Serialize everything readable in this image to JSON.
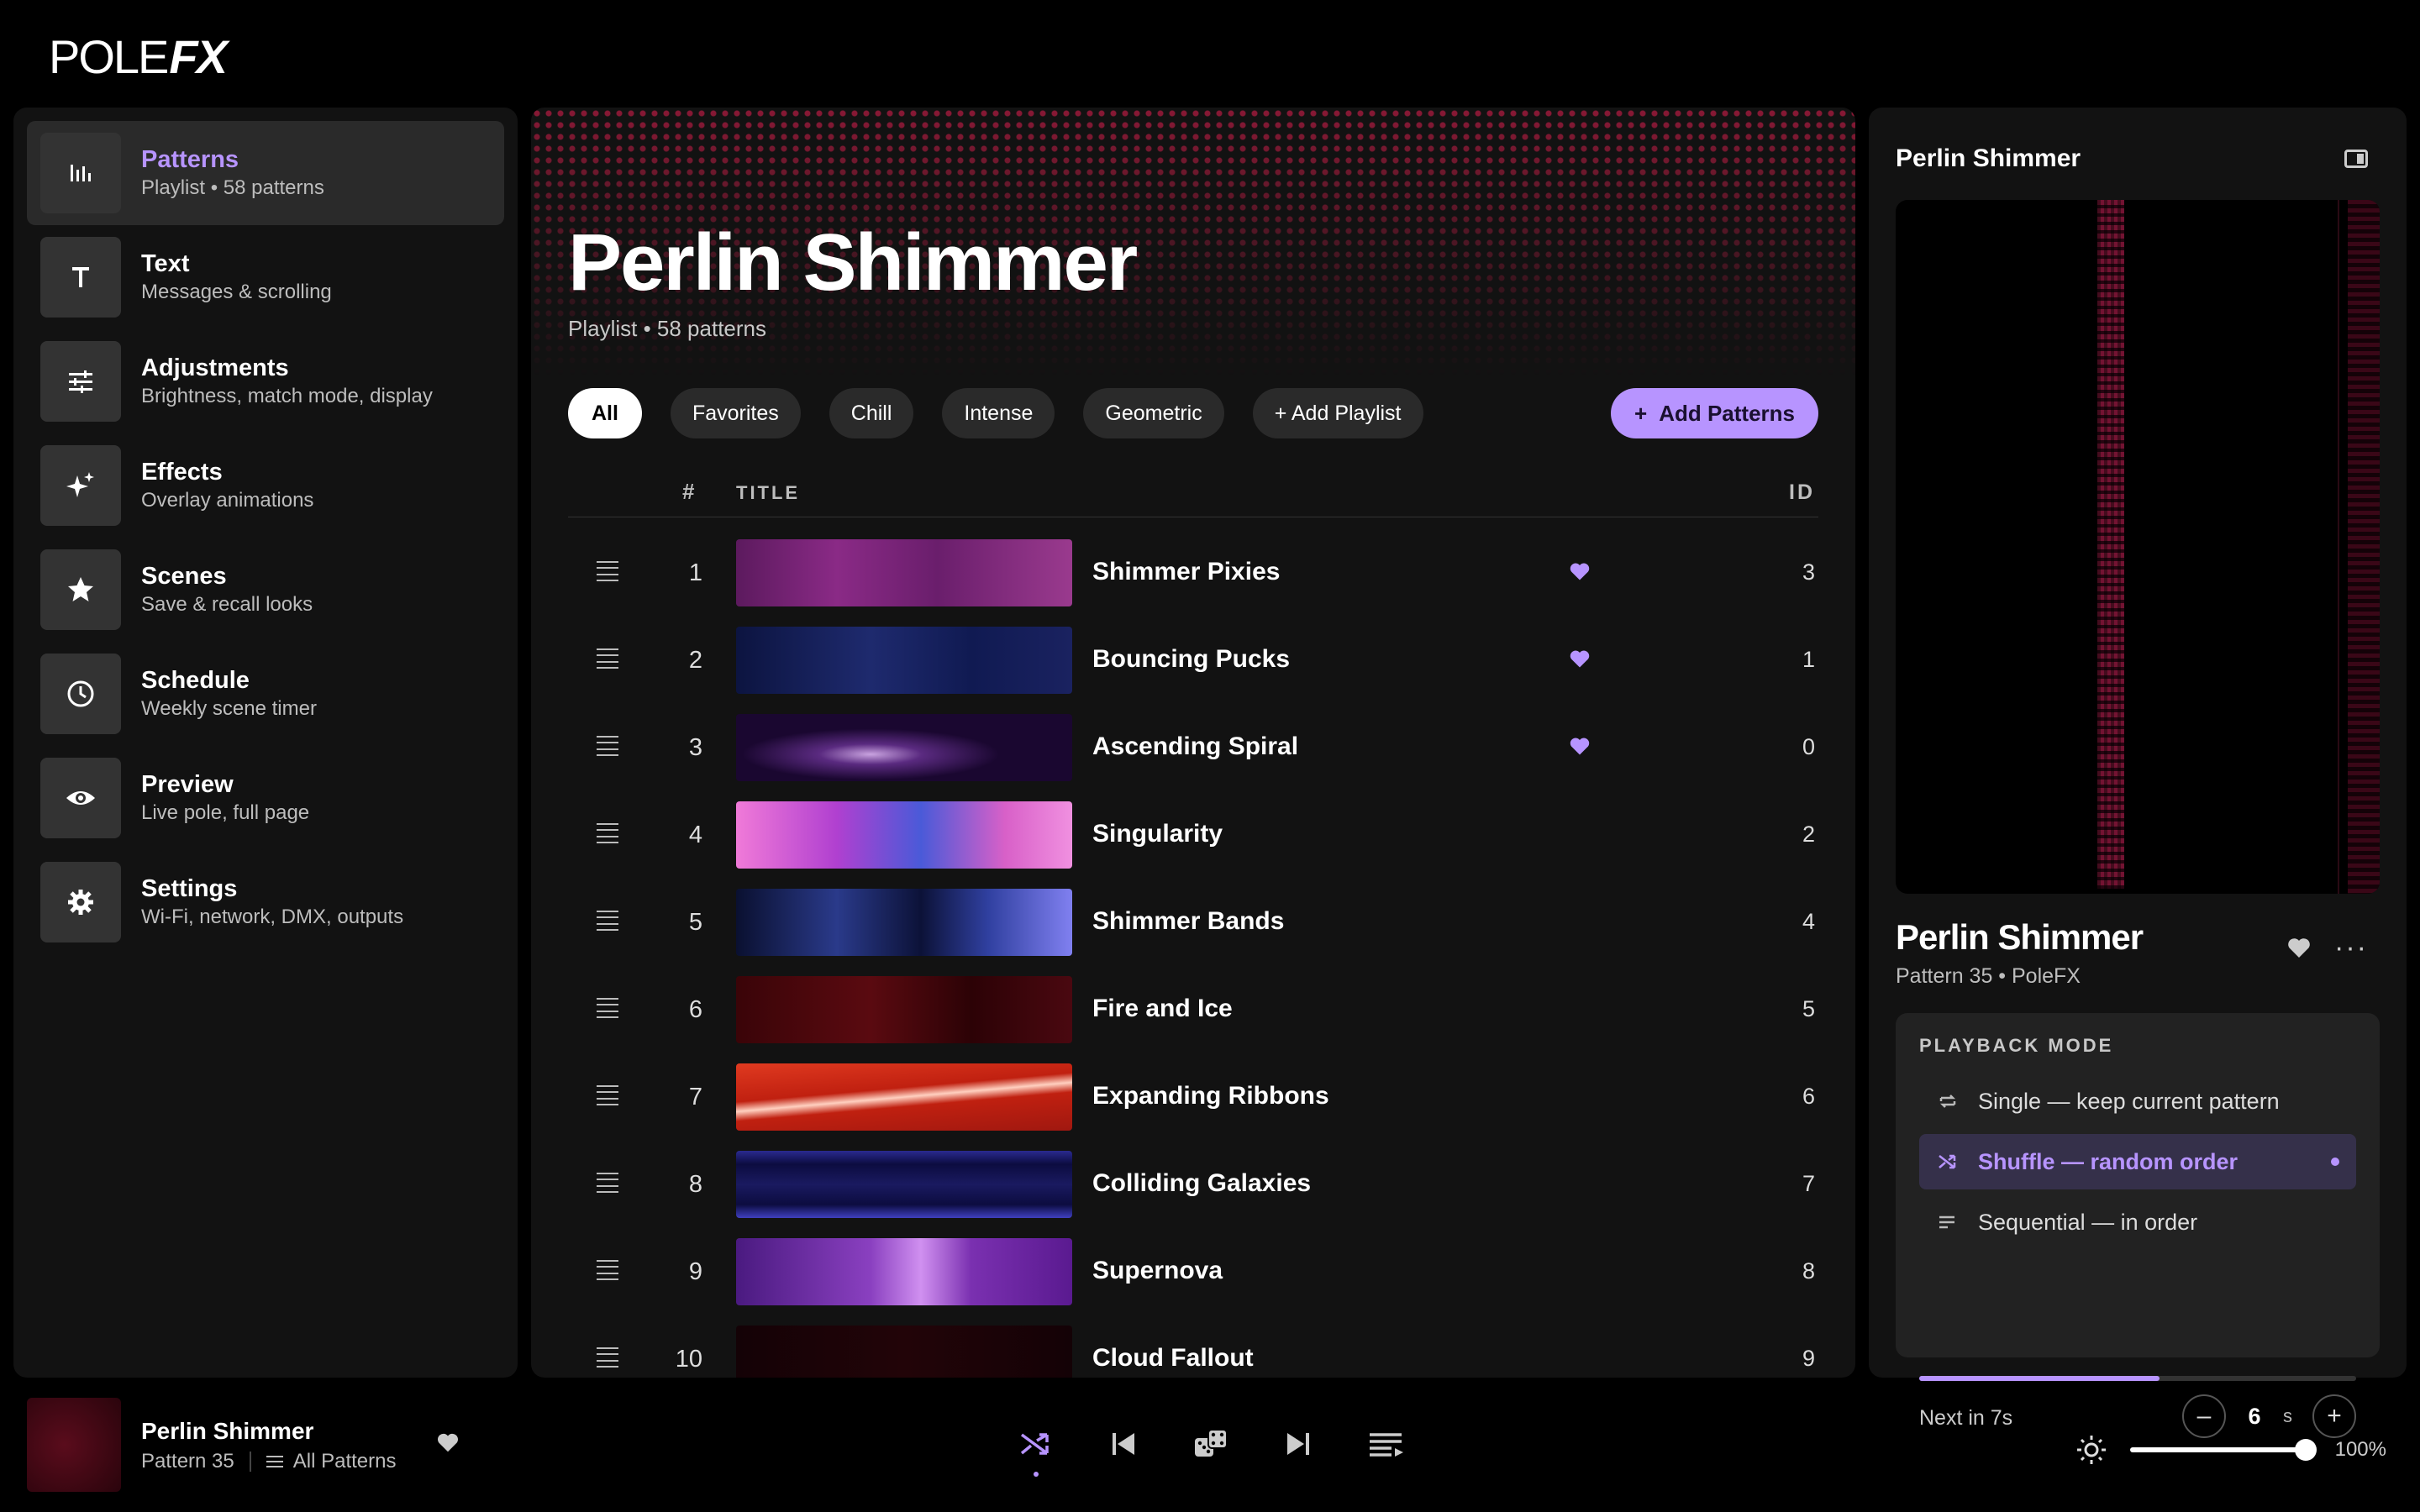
{
  "app": {
    "logo_text_1": "POLE",
    "logo_text_2": "FX"
  },
  "sidebar": {
    "items": [
      {
        "label": "Patterns",
        "sub": "Playlist • 58 patterns",
        "icon": "bar-chart-icon",
        "active": true
      },
      {
        "label": "Text",
        "sub": "Messages & scrolling",
        "icon": "text-icon"
      },
      {
        "label": "Adjustments",
        "sub": "Brightness, match mode, display",
        "icon": "sliders-icon"
      },
      {
        "label": "Effects",
        "sub": "Overlay animations",
        "icon": "sparkles-icon"
      },
      {
        "label": "Scenes",
        "sub": "Save & recall looks",
        "icon": "star-icon"
      },
      {
        "label": "Schedule",
        "sub": "Weekly scene timer",
        "icon": "clock-icon"
      },
      {
        "label": "Preview",
        "sub": "Live pole, full page",
        "icon": "eye-icon"
      },
      {
        "label": "Settings",
        "sub": "Wi-Fi, network, DMX, outputs",
        "icon": "gear-icon"
      }
    ]
  },
  "main": {
    "title": "Perlin Shimmer",
    "subtitle": "Playlist • 58 patterns",
    "chips": [
      "All",
      "Favorites",
      "Chill",
      "Intense",
      "Geometric",
      "+ Add Playlist"
    ],
    "add_button": "Add Patterns",
    "columns": {
      "num": "#",
      "title": "TITLE",
      "id": "ID"
    },
    "rows": [
      {
        "num": "1",
        "name": "Shimmer Pixies",
        "fav": true,
        "id": "3"
      },
      {
        "num": "2",
        "name": "Bouncing Pucks",
        "fav": true,
        "id": "1"
      },
      {
        "num": "3",
        "name": "Ascending Spiral",
        "fav": true,
        "id": "0"
      },
      {
        "num": "4",
        "name": "Singularity",
        "fav": false,
        "id": "2"
      },
      {
        "num": "5",
        "name": "Shimmer Bands",
        "fav": false,
        "id": "4"
      },
      {
        "num": "6",
        "name": "Fire and Ice",
        "fav": false,
        "id": "5"
      },
      {
        "num": "7",
        "name": "Expanding Ribbons",
        "fav": false,
        "id": "6"
      },
      {
        "num": "8",
        "name": "Colliding Galaxies",
        "fav": false,
        "id": "7"
      },
      {
        "num": "9",
        "name": "Supernova",
        "fav": false,
        "id": "8"
      },
      {
        "num": "10",
        "name": "Cloud Fallout",
        "fav": false,
        "id": "9"
      }
    ]
  },
  "right_panel": {
    "title": "Perlin Shimmer",
    "now_playing_title": "Perlin Shimmer",
    "now_playing_sub": "Pattern 35 • PoleFX",
    "playback_label": "PLAYBACK MODE",
    "modes": [
      {
        "label": "Single — keep current pattern",
        "icon": "repeat-icon"
      },
      {
        "label": "Shuffle — random order",
        "icon": "shuffle-icon",
        "active": true
      },
      {
        "label": "Sequential — in order",
        "icon": "list-icon"
      }
    ],
    "progress": 0.55,
    "next_text": "Next in 7s",
    "interval_value": "6",
    "interval_unit": "s",
    "minus": "–",
    "plus": "+"
  },
  "player": {
    "title": "Perlin Shimmer",
    "pattern": "Pattern 35",
    "playlist": "All Patterns",
    "volume_pct": "100%",
    "brightness": 1.0
  },
  "colors": {
    "accent": "#b794ff",
    "bg": "#000000",
    "panel": "#121212"
  }
}
